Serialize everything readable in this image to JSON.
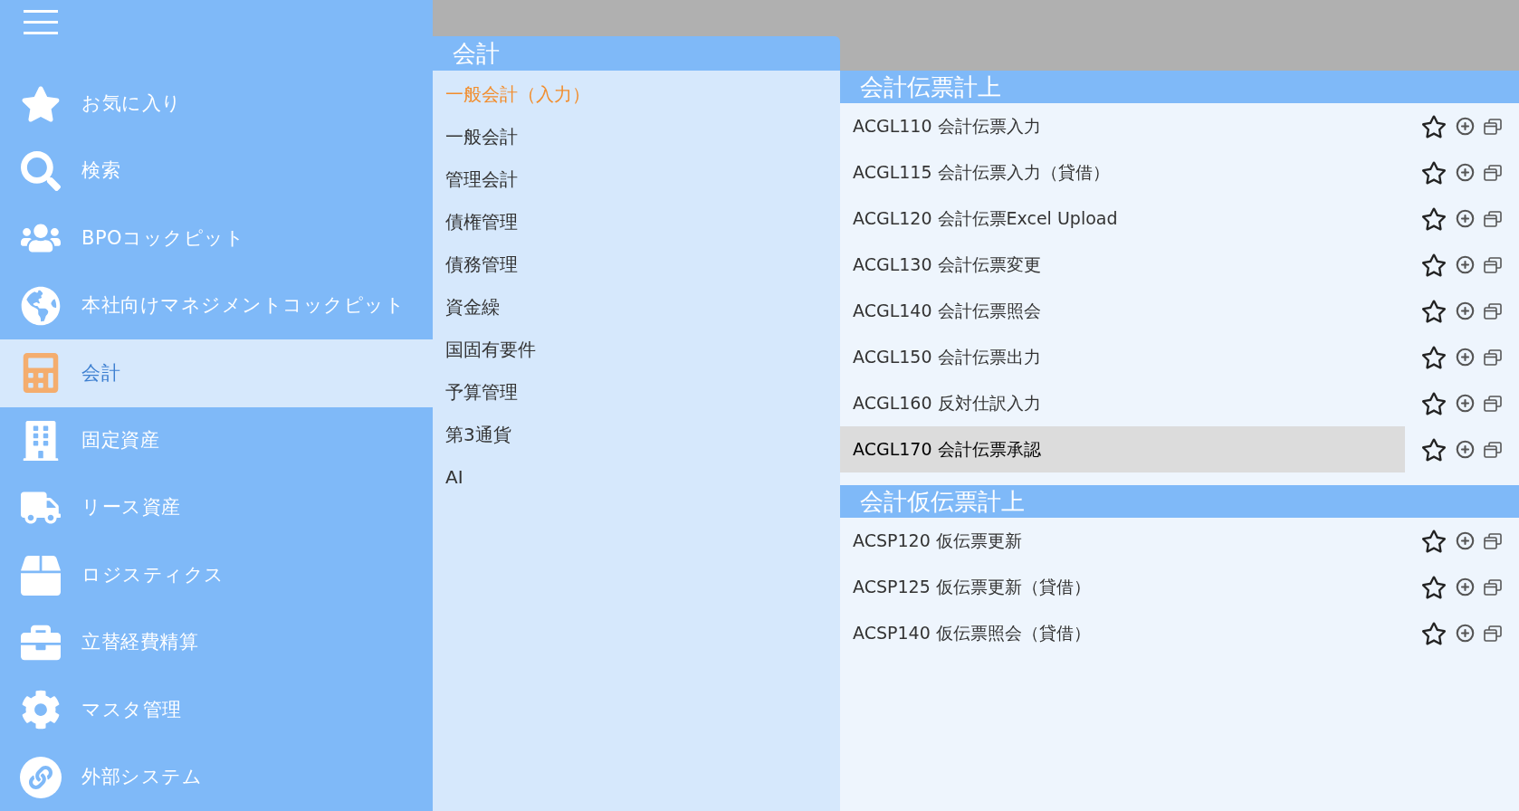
{
  "sidebar": {
    "items": [
      {
        "label": "お気に入り",
        "selected": false
      },
      {
        "label": "検索",
        "selected": false
      },
      {
        "label": "BPOコックピット",
        "selected": false
      },
      {
        "label": "本社向けマネジメントコックピット",
        "selected": false
      },
      {
        "label": "会計",
        "selected": true
      },
      {
        "label": "固定資産",
        "selected": false
      },
      {
        "label": "リース資産",
        "selected": false
      },
      {
        "label": "ロジスティクス",
        "selected": false
      },
      {
        "label": "立替経費精算",
        "selected": false
      },
      {
        "label": "マスタ管理",
        "selected": false
      },
      {
        "label": "外部システム",
        "selected": false
      }
    ]
  },
  "category_panel": {
    "title": "会計",
    "items": [
      {
        "label": "一般会計（入力）",
        "selected": true
      },
      {
        "label": "一般会計",
        "selected": false
      },
      {
        "label": "管理会計",
        "selected": false
      },
      {
        "label": "債権管理",
        "selected": false
      },
      {
        "label": "債務管理",
        "selected": false
      },
      {
        "label": "資金繰",
        "selected": false
      },
      {
        "label": "国固有要件",
        "selected": false
      },
      {
        "label": "予算管理",
        "selected": false
      },
      {
        "label": "第3通貨",
        "selected": false
      },
      {
        "label": "AI",
        "selected": false
      }
    ]
  },
  "function_panel": {
    "sections": [
      {
        "title": "会計伝票計上",
        "rows": [
          {
            "label": "ACGL110 会計伝票入力",
            "selected": false
          },
          {
            "label": "ACGL115 会計伝票入力（貸借）",
            "selected": false
          },
          {
            "label": "ACGL120 会計伝票Excel Upload",
            "selected": false
          },
          {
            "label": "ACGL130 会計伝票変更",
            "selected": false
          },
          {
            "label": "ACGL140 会計伝票照会",
            "selected": false
          },
          {
            "label": "ACGL150 会計伝票出力",
            "selected": false
          },
          {
            "label": "ACGL160 反対仕訳入力",
            "selected": false
          },
          {
            "label": "ACGL170 会計伝票承認",
            "selected": true
          }
        ]
      },
      {
        "title": "会計仮伝票計上",
        "rows": [
          {
            "label": "ACSP120 仮伝票更新",
            "selected": false
          },
          {
            "label": "ACSP125 仮伝票更新（貸借）",
            "selected": false
          },
          {
            "label": "ACSP140 仮伝票照会（貸借）",
            "selected": false
          }
        ]
      }
    ]
  }
}
